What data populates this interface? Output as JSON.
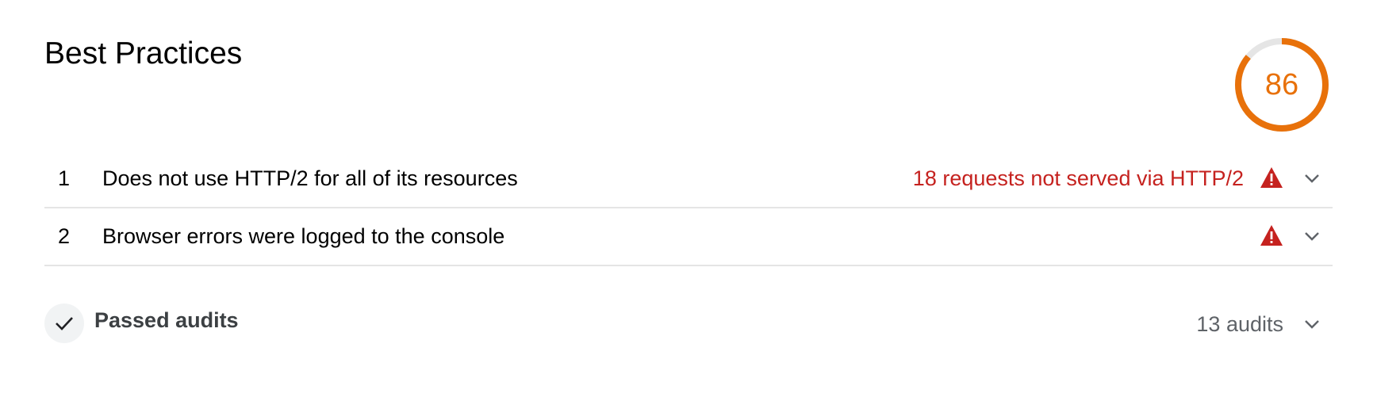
{
  "category": {
    "title": "Best Practices",
    "score": "86",
    "score_fraction": 0.86,
    "score_color": "#e8710a",
    "score_track_color": "#e5e5e5"
  },
  "audits": [
    {
      "index": "1",
      "title": "Does not use HTTP/2 for all of its resources",
      "display_value": "18 requests not served via HTTP/2",
      "status_icon": "warning-triangle-icon",
      "expand_icon": "chevron-down-icon"
    },
    {
      "index": "2",
      "title": "Browser errors were logged to the console",
      "display_value": "",
      "status_icon": "warning-triangle-icon",
      "expand_icon": "chevron-down-icon"
    }
  ],
  "passed": {
    "icon": "checkmark-icon",
    "title": "Passed audits",
    "count": "13 audits",
    "expand_icon": "chevron-down-icon"
  },
  "colors": {
    "fail": "#c5221f",
    "warning_icon": "#c5221f",
    "divider": "#e5e5e5",
    "muted_text": "#5f6368"
  }
}
